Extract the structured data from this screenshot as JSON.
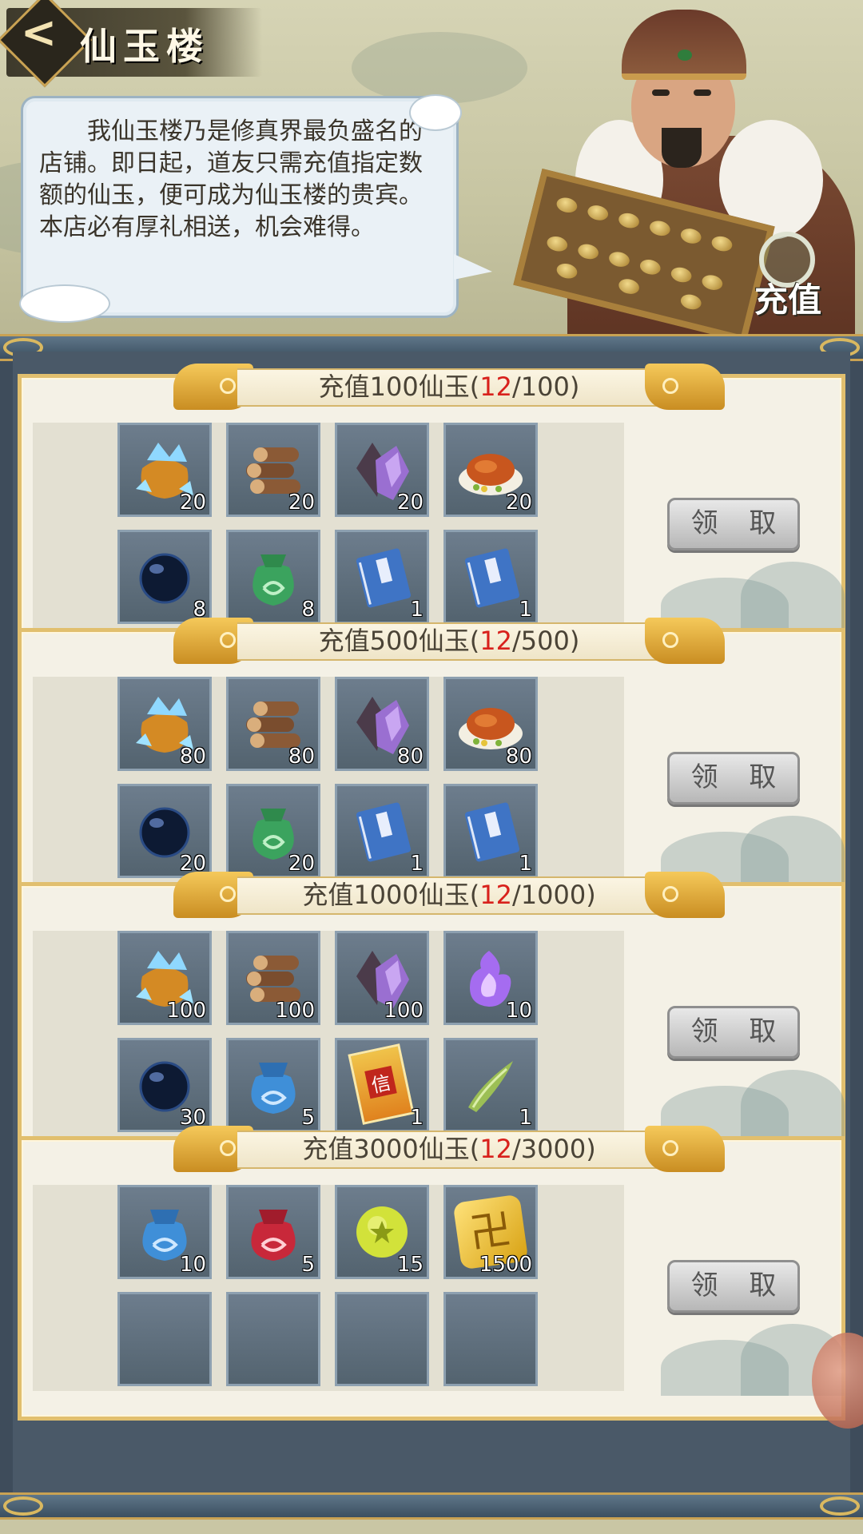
{
  "header": {
    "title": "仙玉楼",
    "back_label": "<",
    "dialog": "我仙玉楼乃是修真界最负盛名的店铺。即日起，道友只需充值指定数额的仙玉，便可成为仙玉楼的贵宾。本店必有厚礼相送，机会难得。",
    "recharge_label": "充值"
  },
  "claim_label": "领 取",
  "tiers": [
    {
      "prefix": "充值100仙玉(",
      "progress": "12",
      "suffix": "/100)",
      "items": [
        {
          "icon": "gem-bag-icon",
          "qty": "20"
        },
        {
          "icon": "logs-icon",
          "qty": "20"
        },
        {
          "icon": "purple-crystal-icon",
          "qty": "20"
        },
        {
          "icon": "roast-duck-icon",
          "qty": "20"
        },
        {
          "icon": "dark-orb-icon",
          "qty": "8"
        },
        {
          "icon": "green-pouch-icon",
          "qty": "8"
        },
        {
          "icon": "blue-book-icon",
          "qty": "1"
        },
        {
          "icon": "blue-book-icon",
          "qty": "1"
        }
      ]
    },
    {
      "prefix": "充值500仙玉(",
      "progress": "12",
      "suffix": "/500)",
      "items": [
        {
          "icon": "gem-bag-icon",
          "qty": "80"
        },
        {
          "icon": "logs-icon",
          "qty": "80"
        },
        {
          "icon": "purple-crystal-icon",
          "qty": "80"
        },
        {
          "icon": "roast-duck-icon",
          "qty": "80"
        },
        {
          "icon": "dark-orb-icon",
          "qty": "20"
        },
        {
          "icon": "green-pouch-icon",
          "qty": "20"
        },
        {
          "icon": "blue-book-icon",
          "qty": "1"
        },
        {
          "icon": "blue-book-icon",
          "qty": "1"
        }
      ]
    },
    {
      "prefix": "充值1000仙玉(",
      "progress": "12",
      "suffix": "/1000)",
      "items": [
        {
          "icon": "gem-bag-icon",
          "qty": "100"
        },
        {
          "icon": "logs-icon",
          "qty": "100"
        },
        {
          "icon": "purple-crystal-icon",
          "qty": "100"
        },
        {
          "icon": "purple-flame-icon",
          "qty": "10"
        },
        {
          "icon": "dark-orb-icon",
          "qty": "30"
        },
        {
          "icon": "blue-pouch-icon",
          "qty": "5"
        },
        {
          "icon": "letter-icon",
          "qty": "1",
          "mark": "信"
        },
        {
          "icon": "jade-horn-icon",
          "qty": "1"
        }
      ]
    },
    {
      "prefix": "充值3000仙玉(",
      "progress": "12",
      "suffix": "/3000)",
      "items": [
        {
          "icon": "blue-pouch-icon",
          "qty": "10"
        },
        {
          "icon": "red-pouch-icon",
          "qty": "5"
        },
        {
          "icon": "yellow-star-orb-icon",
          "qty": "15"
        },
        {
          "icon": "gold-talisman-icon",
          "qty": "1500",
          "mark": "卍"
        },
        {
          "icon": "item-slot",
          "qty": ""
        },
        {
          "icon": "item-slot",
          "qty": ""
        },
        {
          "icon": "item-slot",
          "qty": ""
        },
        {
          "icon": "item-slot",
          "qty": ""
        }
      ]
    }
  ]
}
